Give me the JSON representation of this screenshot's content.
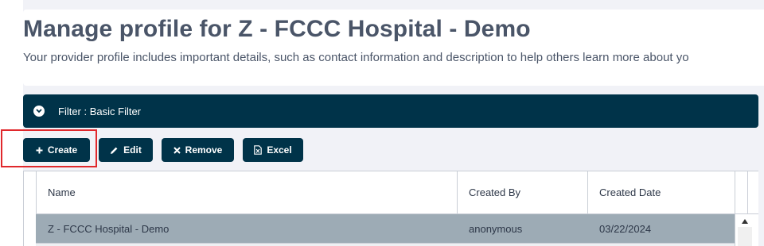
{
  "page": {
    "title": "Manage profile for Z - FCCC Hospital - Demo",
    "description": "Your provider profile includes important details, such as contact information and description to help others learn more about yo"
  },
  "filter": {
    "label": "Filter : Basic Filter",
    "toggle_icon": "chevron-down-circle-icon"
  },
  "toolbar": {
    "create_label": "Create",
    "edit_label": "Edit",
    "remove_label": "Remove",
    "excel_label": "Excel",
    "icons": [
      "plus-icon",
      "pencil-icon",
      "x-icon",
      "excel-file-icon"
    ]
  },
  "table": {
    "columns": [
      "Name",
      "Created By",
      "Created Date"
    ],
    "rows": [
      {
        "name": "Z - FCCC Hospital - Demo",
        "created_by": "anonymous",
        "created_date": "03/22/2024",
        "selected": true
      }
    ]
  },
  "colors": {
    "primary": "#003349",
    "highlight": "#e0282c",
    "selected_row": "#9dabb5",
    "title_text": "#4a5568"
  }
}
